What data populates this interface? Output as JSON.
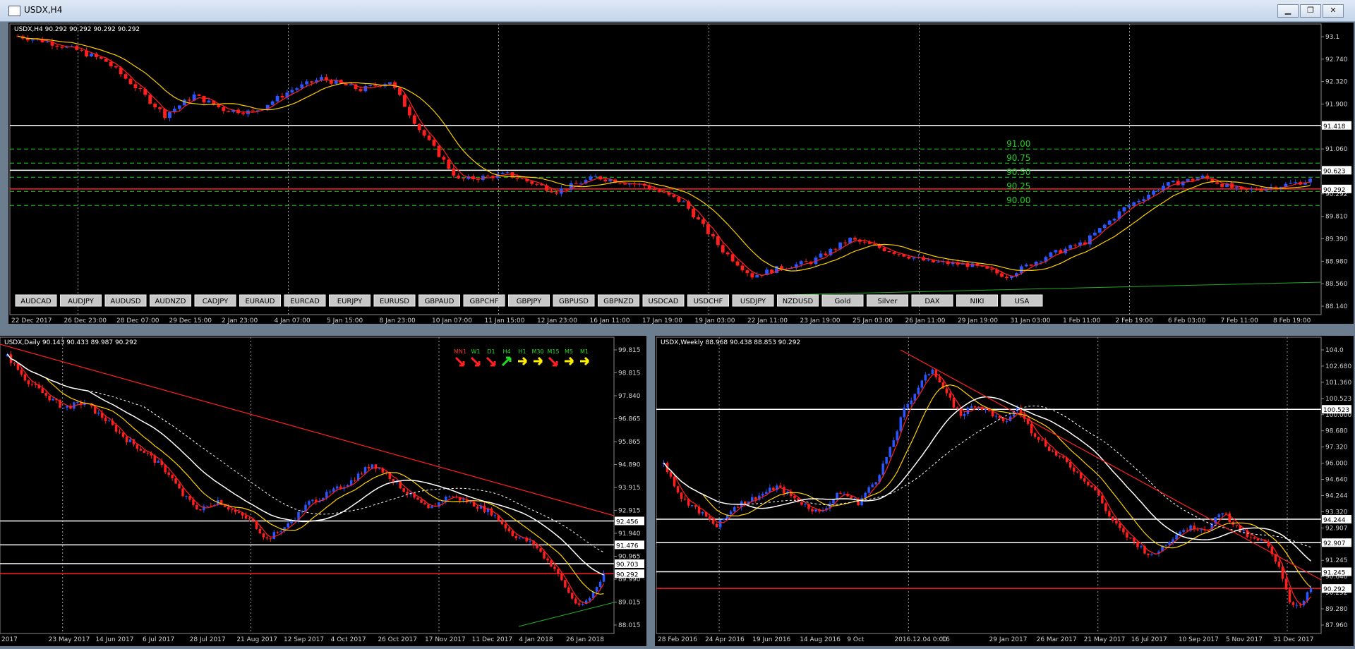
{
  "window": {
    "title": "USDX,H4",
    "buttons": {
      "minimize": "▁",
      "restore": "❐",
      "close": "✕"
    }
  },
  "colors": {
    "bull": "#2a55ff",
    "bear": "#ff1f1f",
    "ma_fast": "#ff2020",
    "ma_slow": "#ffd000",
    "ma_white": "#ffffff",
    "grid": "#3a3a3a",
    "fib": "#22cc22",
    "axis_text": "#cfcfcf"
  },
  "symbol_buttons": [
    "AUDCAD",
    "AUDJPY",
    "AUDUSD",
    "AUDNZD",
    "CADJPY",
    "EURAUD",
    "EURCAD",
    "EURJPY",
    "EURUSD",
    "GBPAUD",
    "GBPCHF",
    "GBPJPY",
    "GBPUSD",
    "GBPNZD",
    "USDCAD",
    "USDCHF",
    "USDJPY",
    "NZDUSD",
    "Gold",
    "Silver",
    "DAX",
    "NIKI",
    "USA"
  ],
  "chart_data": [
    {
      "id": "h4",
      "type": "candlestick",
      "header": "USDX,H4  90.292 90.292 90.292 90.292",
      "ylim": [
        88.14,
        93.14
      ],
      "yticks": [
        "93.1",
        "92.740",
        "92.320",
        "91.900",
        "91.480",
        "91.060",
        "90.623",
        "90.292",
        "89.810",
        "89.390",
        "88.980",
        "88.560",
        "88.140"
      ],
      "xticks": [
        "22 Dec 2017",
        "26 Dec 23:00",
        "28 Dec 07:00",
        "29 Dec 15:00",
        "2 Jan 23:00",
        "4 Jan 07:00",
        "5 Jan 15:00",
        "8 Jan 23:00",
        "10 Jan 07:00",
        "11 Jan 15:00",
        "12 Jan 23:00",
        "16 Jan 11:00",
        "17 Jan 19:00",
        "19 Jan 03:00",
        "22 Jan 11:00",
        "23 Jan 19:00",
        "25 Jan 03:00",
        "26 Jan 11:00",
        "29 Jan 19:00",
        "31 Jan 03:00",
        "1 Feb 11:00",
        "2 Feb 19:00",
        "6 Feb 03:00",
        "7 Feb 11:00",
        "8 Feb 19:00"
      ],
      "hlines": [
        {
          "value": 91.418,
          "label": "91.418",
          "color": "#ffffff"
        },
        {
          "value": 90.623,
          "label": "90.623",
          "color": "#ffffff"
        },
        {
          "value": 90.292,
          "label": "90.292",
          "color": "#ff2020"
        }
      ],
      "fib_levels": [
        {
          "value": 91.0,
          "label": "91.00"
        },
        {
          "value": 90.75,
          "label": "90.75"
        },
        {
          "value": 90.5,
          "label": "90.50"
        },
        {
          "value": 90.25,
          "label": "90.25"
        },
        {
          "value": 90.0,
          "label": "90.00"
        }
      ],
      "close_path": [
        [
          0,
          93.0
        ],
        [
          6,
          92.9
        ],
        [
          12,
          92.75
        ],
        [
          18,
          92.55
        ],
        [
          24,
          92.1
        ],
        [
          30,
          91.6
        ],
        [
          36,
          91.95
        ],
        [
          42,
          91.7
        ],
        [
          48,
          91.65
        ],
        [
          56,
          92.05
        ],
        [
          62,
          92.25
        ],
        [
          70,
          92.05
        ],
        [
          76,
          92.2
        ],
        [
          82,
          91.35
        ],
        [
          90,
          90.45
        ],
        [
          100,
          90.55
        ],
        [
          110,
          90.25
        ],
        [
          118,
          90.5
        ],
        [
          128,
          90.35
        ],
        [
          136,
          90.05
        ],
        [
          144,
          89.2
        ],
        [
          150,
          88.75
        ],
        [
          156,
          88.9
        ],
        [
          162,
          89.0
        ],
        [
          170,
          89.4
        ],
        [
          178,
          89.2
        ],
        [
          186,
          89.0
        ],
        [
          194,
          88.95
        ],
        [
          202,
          88.75
        ],
        [
          210,
          89.1
        ],
        [
          218,
          89.35
        ],
        [
          226,
          89.95
        ],
        [
          234,
          90.35
        ],
        [
          242,
          90.5
        ],
        [
          250,
          90.25
        ],
        [
          258,
          90.35
        ],
        [
          264,
          90.45
        ]
      ]
    },
    {
      "id": "daily",
      "type": "candlestick",
      "header": "USDX,Daily  90.143 90.433 89.987 90.292",
      "ylim": [
        88.015,
        99.815
      ],
      "yticks": [
        "99.815",
        "98.815",
        "97.840",
        "96.865",
        "95.865",
        "94.890",
        "93.915",
        "92.915",
        "91.940",
        "90.965",
        "89.990",
        "89.015",
        "88.015"
      ],
      "xticks": [
        "2017",
        "23 May 2017",
        "14 Jun 2017",
        "6 Jul 2017",
        "28 Jul 2017",
        "21 Aug 2017",
        "12 Sep 2017",
        "4 Oct 2017",
        "26 Oct 2017",
        "17 Nov 2017",
        "11 Dec 2017",
        "4 Jan 2018",
        "26 Jan 2018"
      ],
      "hlines": [
        {
          "value": 92.456,
          "label": "92.456",
          "color": "#ffffff"
        },
        {
          "value": 91.476,
          "label": "91.476",
          "color": "#ffffff"
        },
        {
          "value": 90.703,
          "label": "90.703",
          "color": "#ffffff"
        },
        {
          "value": 90.292,
          "label": "90.292",
          "color": "#ff2020"
        }
      ],
      "indicator_panel": {
        "labels": [
          "MN1",
          "W1",
          "D1",
          "H4",
          "H1",
          "M30",
          "M15",
          "M5",
          "M1"
        ],
        "label_colors": [
          "#ff3030",
          "#22dd22",
          "#22dd22",
          "#22dd22",
          "#22dd22",
          "#22dd22",
          "#22dd22",
          "#22dd22",
          "#22dd22"
        ],
        "arrow_colors": [
          "#ff2020",
          "#ff2020",
          "#ff2020",
          "#22dd22",
          "#ffee00",
          "#ffee00",
          "#ff2020",
          "#ffee00",
          "#ffee00"
        ]
      },
      "close_path": [
        [
          0,
          99.2
        ],
        [
          5,
          98.3
        ],
        [
          10,
          97.7
        ],
        [
          16,
          97.1
        ],
        [
          22,
          97.3
        ],
        [
          28,
          96.6
        ],
        [
          34,
          95.8
        ],
        [
          40,
          95.2
        ],
        [
          46,
          94.4
        ],
        [
          50,
          93.5
        ],
        [
          55,
          92.9
        ],
        [
          60,
          93.3
        ],
        [
          65,
          92.8
        ],
        [
          70,
          92.4
        ],
        [
          74,
          91.7
        ],
        [
          80,
          92.3
        ],
        [
          86,
          93.2
        ],
        [
          92,
          93.6
        ],
        [
          98,
          94.1
        ],
        [
          104,
          94.8
        ],
        [
          108,
          94.4
        ],
        [
          114,
          93.6
        ],
        [
          120,
          92.9
        ],
        [
          126,
          93.5
        ],
        [
          132,
          93.2
        ],
        [
          138,
          92.8
        ],
        [
          144,
          91.9
        ],
        [
          150,
          91.5
        ],
        [
          156,
          90.5
        ],
        [
          160,
          89.5
        ],
        [
          163,
          88.9
        ],
        [
          166,
          89.3
        ],
        [
          170,
          90.3
        ]
      ]
    },
    {
      "id": "weekly",
      "type": "candlestick",
      "header": "USDX,Weekly  88.968 90.438 88.853 90.292",
      "ylim": [
        87.96,
        104.4
      ],
      "yticks": [
        "104.0",
        "102.680",
        "101.360",
        "100.523",
        "100.000",
        "98.680",
        "97.320",
        "96.000",
        "94.640",
        "94.244",
        "93.320",
        "92.907",
        "91.960",
        "91.245",
        "90.640",
        "90.292",
        "89.280",
        "87.960"
      ],
      "xticks": [
        "28 Feb 2016",
        "24 Apr 2016",
        "19 Jun 2016",
        "14 Aug 2016",
        "9 Oct",
        "2016.12.04 0:00",
        "16",
        "29 Jan 2017",
        "26 Mar 2017",
        "21 May 2017",
        "16 Jul 2017",
        "10 Sep 2017",
        "5 Nov 2017",
        "31 Dec 2017"
      ],
      "hlines": [
        {
          "value": 100.523,
          "label": "100.523",
          "color": "#ffffff"
        },
        {
          "value": 94.244,
          "label": "94.244",
          "color": "#ffffff"
        },
        {
          "value": 92.907,
          "label": "92.907",
          "color": "#ffffff"
        },
        {
          "value": 91.245,
          "label": "91.245",
          "color": "#ffffff"
        },
        {
          "value": 90.292,
          "label": "90.292",
          "color": "#ff2020"
        }
      ],
      "close_path": [
        [
          0,
          97.4
        ],
        [
          5,
          95.5
        ],
        [
          10,
          94.7
        ],
        [
          15,
          93.8
        ],
        [
          20,
          95.0
        ],
        [
          26,
          95.5
        ],
        [
          32,
          96.1
        ],
        [
          38,
          95.3
        ],
        [
          44,
          94.6
        ],
        [
          50,
          95.8
        ],
        [
          55,
          95.2
        ],
        [
          60,
          96.5
        ],
        [
          64,
          98.2
        ],
        [
          68,
          100.5
        ],
        [
          72,
          101.8
        ],
        [
          76,
          102.9
        ],
        [
          80,
          101.3
        ],
        [
          84,
          100.2
        ],
        [
          88,
          100.8
        ],
        [
          92,
          100.4
        ],
        [
          96,
          99.7
        ],
        [
          100,
          100.6
        ],
        [
          104,
          99.3
        ],
        [
          110,
          98.1
        ],
        [
          116,
          97.1
        ],
        [
          122,
          95.9
        ],
        [
          126,
          94.4
        ],
        [
          130,
          93.4
        ],
        [
          134,
          92.8
        ],
        [
          138,
          92.1
        ],
        [
          142,
          92.9
        ],
        [
          146,
          93.6
        ],
        [
          150,
          93.8
        ],
        [
          154,
          93.7
        ],
        [
          158,
          94.7
        ],
        [
          162,
          93.8
        ],
        [
          166,
          93.1
        ],
        [
          170,
          92.9
        ],
        [
          174,
          91.6
        ],
        [
          177,
          89.6
        ],
        [
          180,
          89.2
        ],
        [
          183,
          90.3
        ]
      ]
    }
  ]
}
